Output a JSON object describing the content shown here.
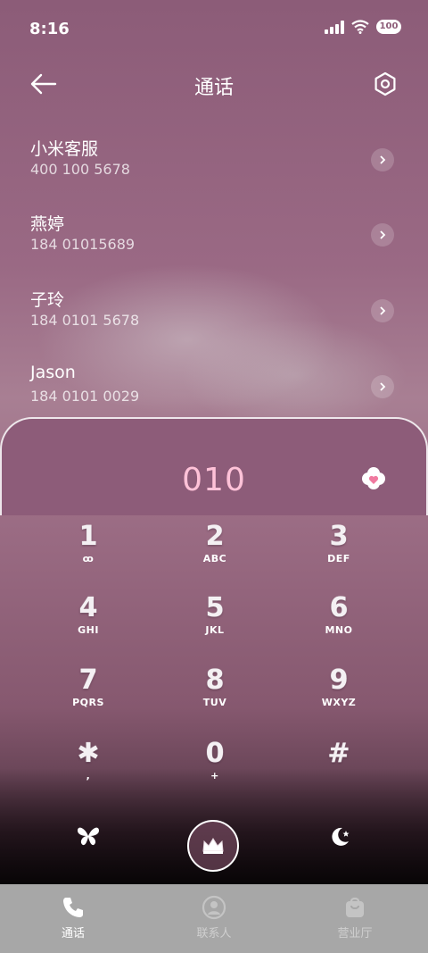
{
  "status_bar": {
    "time": "8:16",
    "battery": "100"
  },
  "header": {
    "title": "通话"
  },
  "contacts": [
    {
      "name": "小米客服",
      "number": "400 100 5678"
    },
    {
      "name": "燕婷",
      "number": "184 01015689"
    },
    {
      "name": "子玲",
      "number": "184 0101 5678"
    },
    {
      "name": "Jason",
      "number": "184 0101 0029"
    }
  ],
  "dialer": {
    "entered_number": "010",
    "keys": [
      {
        "digit": "1",
        "letters": "ꝏ"
      },
      {
        "digit": "2",
        "letters": "ABC"
      },
      {
        "digit": "3",
        "letters": "DEF"
      },
      {
        "digit": "4",
        "letters": "GHI"
      },
      {
        "digit": "5",
        "letters": "JKL"
      },
      {
        "digit": "6",
        "letters": "MNO"
      },
      {
        "digit": "7",
        "letters": "PQRS"
      },
      {
        "digit": "8",
        "letters": "TUV"
      },
      {
        "digit": "9",
        "letters": "WXYZ"
      },
      {
        "digit": "✱",
        "letters": ","
      },
      {
        "digit": "0",
        "letters": "+"
      },
      {
        "digit": "#",
        "letters": ""
      }
    ]
  },
  "tabs": [
    {
      "label": "通话",
      "active": true
    },
    {
      "label": "联系人",
      "active": false
    },
    {
      "label": "营业厅",
      "active": false
    }
  ],
  "colors": {
    "accent_number": "#ffc2d8",
    "panel": "#8d5c79",
    "tabbar": "#a7a7a7"
  }
}
